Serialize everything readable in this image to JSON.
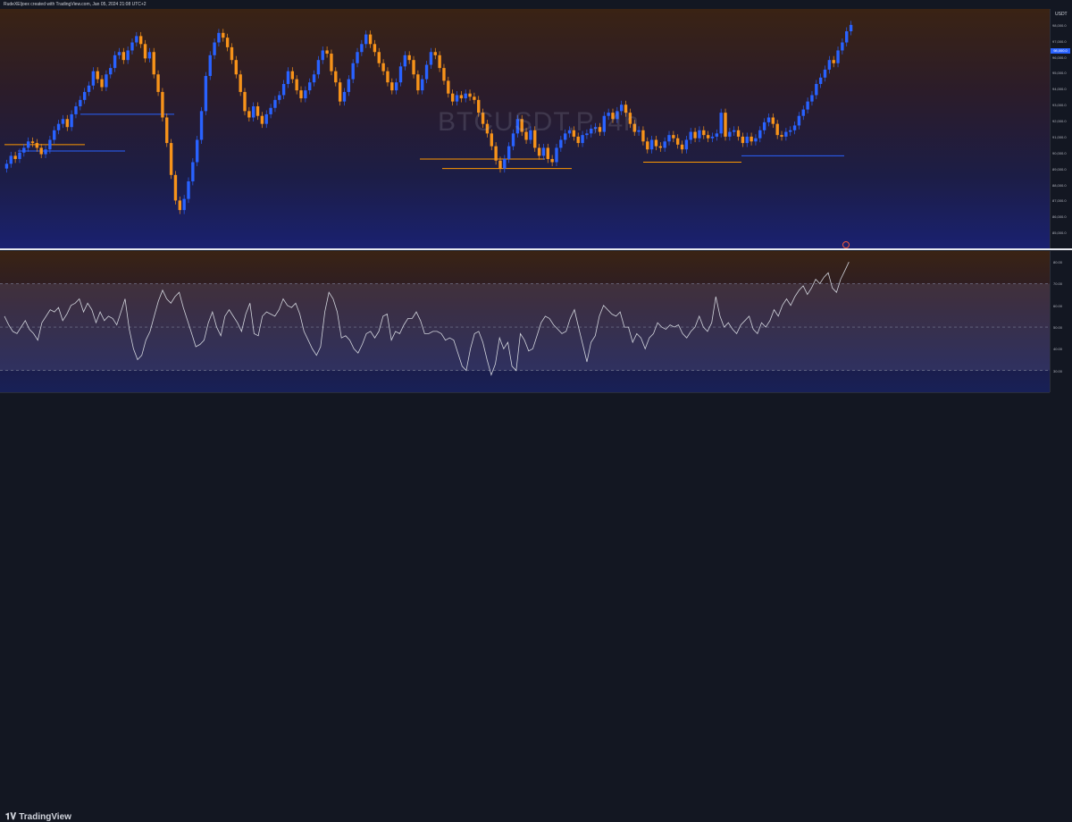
{
  "header": {
    "caption": "RudeXEljoex created with TradingView.com, Jan 05, 2024 21:08 UTC+2"
  },
  "watermark": {
    "symbol": "BTCUSDT.P, 4h"
  },
  "axis": {
    "top_right_label": "USDT"
  },
  "footer": {
    "brand": "TradingView"
  },
  "icons": {
    "brand_logo": "tradingview-logo-icon"
  },
  "colors": {
    "bull": "#2962ff",
    "bear": "#f7931a",
    "rsi": "#d1d4dc",
    "hline": "#ff9800",
    "support": "#2962ff"
  },
  "chart_data": [
    {
      "type": "candlestick",
      "title": "BTCUSDT.P, 4h",
      "symbol": "BTCUSDT.P",
      "timeframe": "4h",
      "ylim": [
        84000,
        99000
      ],
      "price_scale_labels": [
        "98,000.0",
        "97,000.0",
        "96,000.0",
        "95,000.0",
        "94,000.0",
        "93,000.0",
        "92,000.0",
        "91,000.0",
        "90,000.0",
        "89,000.0",
        "88,000.0",
        "87,000.0",
        "86,000.0",
        "85,000.0"
      ],
      "last_price": "98,000.0",
      "close": [
        89300,
        89800,
        89600,
        90000,
        90300,
        90700,
        90600,
        90300,
        89900,
        90200,
        90800,
        91400,
        91800,
        92100,
        91600,
        92400,
        92900,
        93300,
        93800,
        94200,
        95100,
        94600,
        94100,
        94900,
        95300,
        96100,
        96300,
        95800,
        96400,
        96900,
        97300,
        96800,
        95900,
        96300,
        94900,
        93800,
        92200,
        90600,
        88600,
        87000,
        86400,
        87100,
        88200,
        89400,
        90800,
        92600,
        94800,
        96100,
        96900,
        97500,
        97200,
        96600,
        95800,
        94900,
        93800,
        92600,
        92200,
        92900,
        92300,
        91800,
        92400,
        92800,
        93300,
        93600,
        94300,
        95100,
        94600,
        93900,
        93400,
        93900,
        94400,
        94900,
        95800,
        96400,
        96200,
        95100,
        94400,
        93200,
        93800,
        94600,
        95600,
        96300,
        96800,
        97400,
        96800,
        96300,
        95600,
        95100,
        94400,
        93900,
        94400,
        95400,
        96100,
        95800,
        94900,
        93900,
        94600,
        95500,
        96300,
        96100,
        95300,
        94500,
        93700,
        93200,
        93600,
        93400,
        93700,
        93500,
        93300,
        92500,
        91800,
        91200,
        90400,
        89500,
        89000,
        89600,
        90400,
        91200,
        92100,
        91300,
        90800,
        91400,
        90300,
        89800,
        90300,
        89600,
        89400,
        90300,
        90800,
        91200,
        91400,
        91000,
        90600,
        91100,
        91200,
        91500,
        91600,
        91300,
        92300,
        92500,
        92100,
        92600,
        93000,
        92500,
        91800,
        91300,
        91400,
        90700,
        90200,
        90800,
        90400,
        90300,
        90700,
        91100,
        90900,
        90500,
        90200,
        90800,
        91300,
        90900,
        91400,
        91100,
        90900,
        91000,
        91200,
        92500,
        91000,
        91300,
        91400,
        91000,
        90600,
        91000,
        90700,
        90900,
        91400,
        91900,
        92200,
        91800,
        91100,
        91000,
        91300,
        91400,
        91700,
        92300,
        92700,
        93200,
        93600,
        94300,
        94700,
        95200,
        95800,
        95600,
        96400,
        96900,
        97600,
        98000
      ],
      "orange_levels": [
        90500,
        89000,
        89400,
        89600
      ],
      "blue_levels": [
        92400,
        90100,
        89800,
        89600,
        89800
      ],
      "support_line": 89800
    },
    {
      "type": "line",
      "series": [
        {
          "name": "RSI (14)"
        }
      ],
      "ylim": [
        20,
        85
      ],
      "levels": [
        70,
        50,
        30
      ],
      "values": [
        55,
        51,
        48,
        47,
        50,
        53,
        49,
        47,
        44,
        52,
        55,
        58,
        57,
        59,
        53,
        56,
        60,
        61,
        63,
        57,
        61,
        58,
        52,
        57,
        53,
        55,
        54,
        51,
        57,
        63,
        49,
        40,
        35,
        37,
        44,
        48,
        55,
        62,
        67,
        63,
        61,
        64,
        66,
        59,
        53,
        47,
        41,
        42,
        44,
        52,
        57,
        50,
        46,
        55,
        58,
        55,
        52,
        48,
        56,
        61,
        47,
        46,
        55,
        57,
        56,
        55,
        58,
        63,
        60,
        59,
        61,
        56,
        48,
        44,
        40,
        37,
        41,
        57,
        66,
        63,
        57,
        45,
        46,
        44,
        40,
        38,
        42,
        47,
        48,
        45,
        48,
        55,
        56,
        44,
        48,
        47,
        51,
        54,
        54,
        57,
        53,
        47,
        47,
        48,
        48,
        47,
        44,
        45,
        44,
        38,
        32,
        30,
        40,
        47,
        48,
        43,
        35,
        28,
        33,
        45,
        40,
        43,
        32,
        30,
        47,
        44,
        39,
        40,
        46,
        52,
        55,
        54,
        51,
        49,
        47,
        48,
        54,
        58,
        50,
        42,
        34,
        43,
        46,
        55,
        60,
        58,
        56,
        55,
        57,
        50,
        50,
        43,
        47,
        45,
        40,
        45,
        47,
        52,
        50,
        49,
        51,
        50,
        51,
        47,
        45,
        48,
        50,
        55,
        50,
        48,
        52,
        64,
        55,
        50,
        52,
        49,
        47,
        51,
        53,
        55,
        49,
        47,
        52,
        50,
        53,
        58,
        55,
        60,
        63,
        60,
        64,
        67,
        69,
        65,
        68,
        72,
        70,
        73,
        75,
        68,
        66,
        72,
        76,
        80
      ]
    }
  ]
}
